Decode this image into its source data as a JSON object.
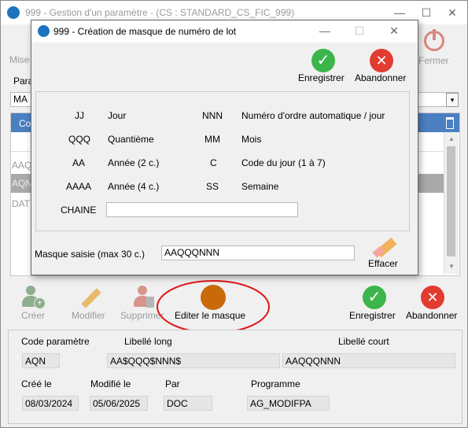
{
  "main_window": {
    "title": "999 - Gestion d'un paramètre - (CS : STANDARD_CS_FIC_999)",
    "minimize": "—",
    "maximize": "☐",
    "close": "✕",
    "toolbar_left_label": "Mise",
    "param_label": "Para",
    "param_value": "MA",
    "grid_header": "Co",
    "list_rows": [
      "AAQ",
      "AQN",
      "DAT"
    ],
    "close_button_label": "Fermer",
    "actions": {
      "create": "Créer",
      "modify": "Modifier",
      "delete": "Supprimer",
      "edit_mask": "Editer le masque",
      "save": "Enregistrer",
      "cancel": "Abandonner"
    },
    "details": {
      "code_label": "Code paramètre",
      "long_label": "Libellé long",
      "short_label": "Libellé court",
      "code_value": "AQN",
      "long_value": "AA$QQQ$NNN$",
      "short_value": "AAQQQNNN",
      "created_label": "Créé le",
      "modified_label": "Modifié le",
      "by_label": "Par",
      "program_label": "Programme",
      "created_value": "08/03/2024",
      "modified_value": "05/06/2025",
      "by_value": "DOC",
      "program_value": "AG_MODIFPA"
    }
  },
  "dialog": {
    "title": "999 - Création de masque de numéro de lot",
    "save_label": "Enregistrer",
    "cancel_label": "Abandonner",
    "legend": [
      {
        "code": "JJ",
        "desc": "Jour",
        "code2": "NNN",
        "desc2": "Numéro d'ordre automatique / jour"
      },
      {
        "code": "QQQ",
        "desc": "Quantième",
        "code2": "MM",
        "desc2": "Mois"
      },
      {
        "code": "AA",
        "desc": "Année (2 c.)",
        "code2": "C",
        "desc2": "Code du jour (1 à 7)"
      },
      {
        "code": "AAAA",
        "desc": "Année (4 c.)",
        "code2": "SS",
        "desc2": "Semaine"
      }
    ],
    "chaine_label": "CHAINE",
    "chaine_value": "",
    "mask_label": "Masque saisie (max 30 c.)",
    "mask_value": "AAQQQNNN",
    "clear_label": "Effacer"
  },
  "colors": {
    "save_green": "#3cb54a",
    "cancel_red": "#e23b30",
    "highlight_orange": "#c8690a",
    "annotation_red": "#e01515",
    "grid_header_blue": "#4a7fc1",
    "selected_row": "#a9a9a9"
  }
}
